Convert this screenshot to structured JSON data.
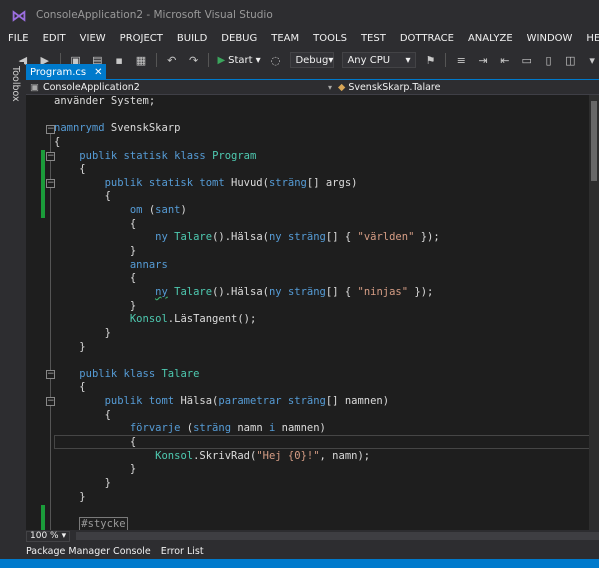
{
  "window": {
    "title": "ConsoleApplication2 - Microsoft Visual Studio"
  },
  "menu": [
    "FILE",
    "EDIT",
    "VIEW",
    "PROJECT",
    "BUILD",
    "DEBUG",
    "TEAM",
    "TOOLS",
    "TEST",
    "DOTTRACE",
    "ANALYZE",
    "WINDOW",
    "HELP"
  ],
  "toolbar": {
    "start_label": "Start",
    "config": "Debug",
    "platform": "Any CPU"
  },
  "sidebar": {
    "toolbox_label": "Toolbox"
  },
  "editor_tab": {
    "label": "Program.cs"
  },
  "navbar": {
    "project": "ConsoleApplication2",
    "member": "SvenskSkarp.Talare"
  },
  "code_lines": [
    [
      [
        "pl",
        "använder System;"
      ]
    ],
    [
      [
        "pl",
        ""
      ]
    ],
    [
      [
        "kw",
        "namnrymd"
      ],
      [
        "pl",
        " SvenskSkarp"
      ]
    ],
    [
      [
        "pl",
        "{"
      ]
    ],
    [
      [
        "pl",
        "    "
      ],
      [
        "kw",
        "publik statisk klass"
      ],
      [
        "pl",
        " "
      ],
      [
        "ty",
        "Program"
      ]
    ],
    [
      [
        "pl",
        "    {"
      ]
    ],
    [
      [
        "pl",
        "        "
      ],
      [
        "kw",
        "publik statisk tomt"
      ],
      [
        "pl",
        " Huvud("
      ],
      [
        "kw",
        "sträng"
      ],
      [
        "pl",
        "[] args)"
      ]
    ],
    [
      [
        "pl",
        "        {"
      ]
    ],
    [
      [
        "pl",
        "            "
      ],
      [
        "kw",
        "om"
      ],
      [
        "pl",
        " ("
      ],
      [
        "kw",
        "sant"
      ],
      [
        "pl",
        ")"
      ]
    ],
    [
      [
        "pl",
        "            {"
      ]
    ],
    [
      [
        "pl",
        "                "
      ],
      [
        "kw",
        "ny"
      ],
      [
        "pl",
        " "
      ],
      [
        "ty",
        "Talare"
      ],
      [
        "pl",
        "().Hälsa("
      ],
      [
        "kw",
        "ny sträng"
      ],
      [
        "pl",
        "[] { "
      ],
      [
        "st",
        "\"världen\""
      ],
      [
        "pl",
        " });"
      ]
    ],
    [
      [
        "pl",
        "            }"
      ]
    ],
    [
      [
        "pl",
        "            "
      ],
      [
        "kw",
        "annars"
      ]
    ],
    [
      [
        "pl",
        "            {"
      ]
    ],
    [
      [
        "pl",
        "                "
      ],
      [
        "kwsq",
        "ny"
      ],
      [
        "pl",
        " "
      ],
      [
        "ty",
        "Talare"
      ],
      [
        "pl",
        "().Hälsa("
      ],
      [
        "kw",
        "ny sträng"
      ],
      [
        "pl",
        "[] { "
      ],
      [
        "st",
        "\"ninjas\""
      ],
      [
        "pl",
        " });"
      ]
    ],
    [
      [
        "pl",
        "            }"
      ]
    ],
    [
      [
        "pl",
        "            "
      ],
      [
        "ty",
        "Konsol"
      ],
      [
        "pl",
        ".LäsTangent();"
      ]
    ],
    [
      [
        "pl",
        "        }"
      ]
    ],
    [
      [
        "pl",
        "    }"
      ]
    ],
    [
      [
        "pl",
        ""
      ]
    ],
    [
      [
        "pl",
        "    "
      ],
      [
        "kw",
        "publik klass"
      ],
      [
        "pl",
        " "
      ],
      [
        "ty",
        "Talare"
      ]
    ],
    [
      [
        "pl",
        "    {"
      ]
    ],
    [
      [
        "pl",
        "        "
      ],
      [
        "kw",
        "publik tomt"
      ],
      [
        "pl",
        " Hälsa("
      ],
      [
        "kw",
        "parametrar sträng"
      ],
      [
        "pl",
        "[] namnen)"
      ]
    ],
    [
      [
        "pl",
        "        {"
      ]
    ],
    [
      [
        "pl",
        "            "
      ],
      [
        "kw",
        "förvarje"
      ],
      [
        "pl",
        " ("
      ],
      [
        "kw",
        "sträng"
      ],
      [
        "pl",
        " namn "
      ],
      [
        "kw",
        "i"
      ],
      [
        "pl",
        " namnen)"
      ]
    ],
    [
      [
        "pl",
        "            {"
      ]
    ],
    [
      [
        "pl",
        "                "
      ],
      [
        "ty",
        "Konsol"
      ],
      [
        "pl",
        ".SkrivRad("
      ],
      [
        "st",
        "\"Hej {0}!\""
      ],
      [
        "pl",
        ", namn);"
      ]
    ],
    [
      [
        "pl",
        "            }"
      ]
    ],
    [
      [
        "pl",
        "        }"
      ]
    ],
    [
      [
        "pl",
        "    }"
      ]
    ],
    [
      [
        "pl",
        ""
      ]
    ],
    [
      [
        "pl",
        "    "
      ],
      [
        "region",
        "#stycke"
      ]
    ]
  ],
  "zoom": "100 %",
  "bottom_tabs": [
    "Package Manager Console",
    "Error List"
  ]
}
